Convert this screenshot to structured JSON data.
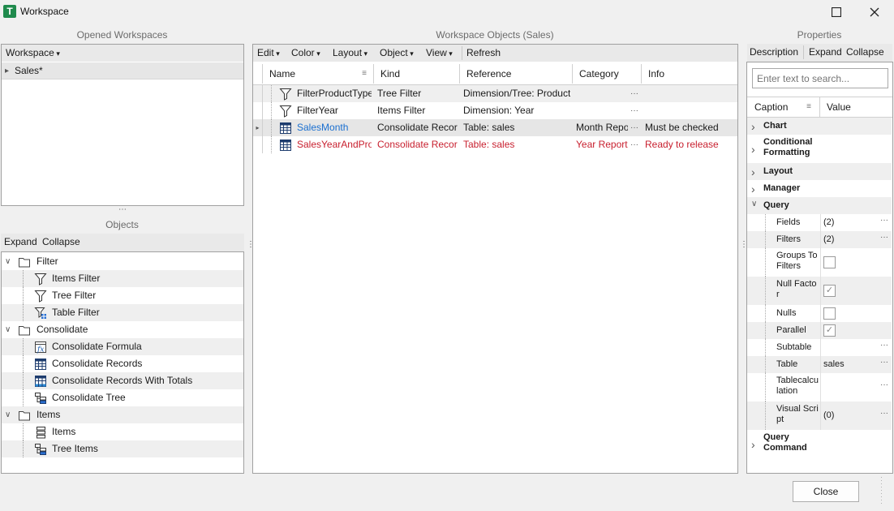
{
  "window": {
    "title": "Workspace",
    "icon_letter": "T",
    "maximize_icon": "maximize-icon",
    "close_icon": "close-icon"
  },
  "left_top": {
    "title": "Opened Workspaces",
    "toolbar": {
      "workspace_label": "Workspace"
    },
    "items": [
      {
        "label": "Sales*"
      }
    ]
  },
  "objects_panel": {
    "title": "Objects",
    "toolbar": {
      "expand": "Expand",
      "collapse": "Collapse"
    },
    "tree": [
      {
        "label": "Filter",
        "type": "group",
        "icon": "folder-icon"
      },
      {
        "label": "Items Filter",
        "type": "item",
        "icon": "filter-icon"
      },
      {
        "label": "Tree Filter",
        "type": "item",
        "icon": "filter-icon"
      },
      {
        "label": "Table Filter",
        "type": "item",
        "icon": "table-filter-icon"
      },
      {
        "label": "Consolidate",
        "type": "group",
        "icon": "folder-icon"
      },
      {
        "label": "Consolidate Formula",
        "type": "item",
        "icon": "formula-icon"
      },
      {
        "label": "Consolidate Records",
        "type": "item",
        "icon": "grid-icon"
      },
      {
        "label": "Consolidate Records With Totals",
        "type": "item",
        "icon": "grid-totals-icon"
      },
      {
        "label": "Consolidate Tree",
        "type": "item",
        "icon": "tree-icon"
      },
      {
        "label": "Items",
        "type": "group",
        "icon": "folder-icon"
      },
      {
        "label": "Items",
        "type": "item",
        "icon": "list-icon"
      },
      {
        "label": "Tree Items",
        "type": "item",
        "icon": "tree-icon"
      }
    ]
  },
  "center": {
    "title": "Workspace Objects (Sales)",
    "toolbar": {
      "edit": "Edit",
      "color": "Color",
      "layout": "Layout",
      "object": "Object",
      "view": "View",
      "refresh": "Refresh"
    },
    "columns": {
      "name": "Name",
      "kind": "Kind",
      "reference": "Reference",
      "category": "Category",
      "info": "Info"
    },
    "rows": [
      {
        "name": "FilterProductType",
        "kind": "Tree Filter",
        "reference": "Dimension/Tree: Product/",
        "category": "",
        "info": "",
        "icon": "filter-icon",
        "style": "normal"
      },
      {
        "name": "FilterYear",
        "kind": "Items Filter",
        "reference": "Dimension: Year",
        "category": "",
        "info": "",
        "icon": "filter-icon",
        "style": "normal"
      },
      {
        "name": "SalesMonth",
        "kind": "Consolidate Records",
        "reference": "Table: sales",
        "category": "Month Report",
        "info": "Must be checked",
        "icon": "grid-icon",
        "style": "blue"
      },
      {
        "name": "SalesYearAndProd",
        "kind": "Consolidate Records",
        "reference": "Table: sales",
        "category": "Year Report",
        "info": "Ready to release",
        "icon": "grid-icon",
        "style": "red"
      }
    ]
  },
  "properties": {
    "title": "Properties",
    "toolbar": {
      "description": "Description",
      "expand": "Expand",
      "collapse": "Collapse"
    },
    "search_placeholder": "Enter text to search...",
    "columns": {
      "caption": "Caption",
      "value": "Value"
    },
    "rows": [
      {
        "caption": "Chart",
        "value": "",
        "kind": "category",
        "expanded": false
      },
      {
        "caption": "Conditional Formatting",
        "value": "",
        "kind": "category",
        "expanded": false
      },
      {
        "caption": "Layout",
        "value": "",
        "kind": "category",
        "expanded": false
      },
      {
        "caption": "Manager",
        "value": "",
        "kind": "category",
        "expanded": false
      },
      {
        "caption": "Query",
        "value": "",
        "kind": "category",
        "expanded": true
      },
      {
        "caption": "Fields",
        "value": "(2)",
        "kind": "text",
        "dots": true
      },
      {
        "caption": "Filters",
        "value": "(2)",
        "kind": "text",
        "dots": true
      },
      {
        "caption": "Groups To Filters",
        "value": "",
        "kind": "check",
        "checked": false
      },
      {
        "caption": "Null Factor",
        "value": "",
        "kind": "check",
        "checked": true
      },
      {
        "caption": "Nulls",
        "value": "",
        "kind": "check",
        "checked": false
      },
      {
        "caption": "Parallel",
        "value": "",
        "kind": "check",
        "checked": true
      },
      {
        "caption": "Subtable",
        "value": "",
        "kind": "text",
        "dots": true
      },
      {
        "caption": "Table",
        "value": "sales",
        "kind": "text",
        "dots": true
      },
      {
        "caption": "Tablecalculation",
        "value": "",
        "kind": "text",
        "dots": true
      },
      {
        "caption": "Visual Script",
        "value": "(0)",
        "kind": "text",
        "dots": true
      },
      {
        "caption": "Query Command",
        "value": "",
        "kind": "category",
        "expanded": false
      }
    ]
  },
  "footer": {
    "close": "Close"
  }
}
